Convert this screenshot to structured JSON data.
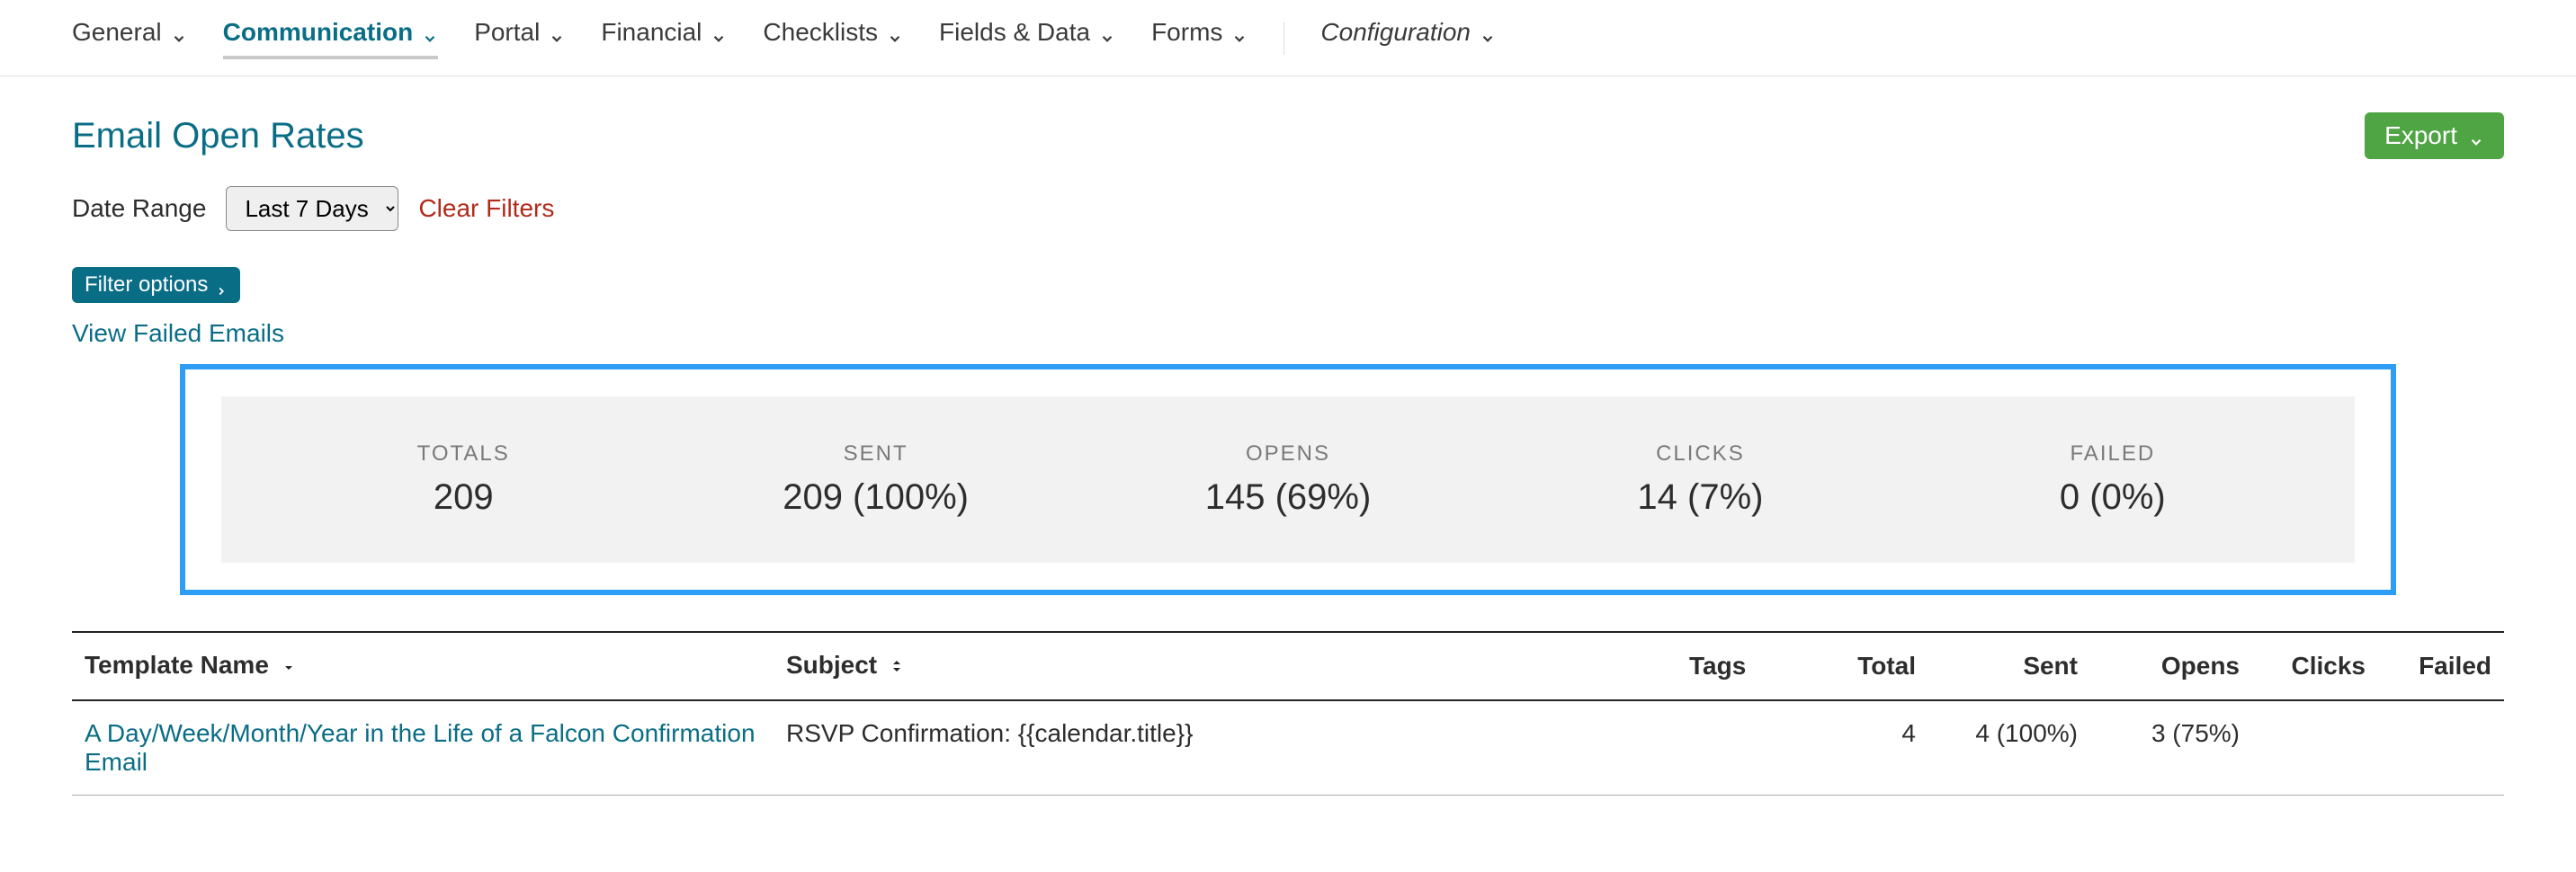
{
  "nav": {
    "items": [
      {
        "label": "General"
      },
      {
        "label": "Communication",
        "active": true
      },
      {
        "label": "Portal"
      },
      {
        "label": "Financial"
      },
      {
        "label": "Checklists"
      },
      {
        "label": "Fields & Data"
      },
      {
        "label": "Forms"
      }
    ],
    "config_label": "Configuration"
  },
  "header": {
    "title": "Email Open Rates",
    "export_label": "Export"
  },
  "filters": {
    "date_range_label": "Date Range",
    "date_range_value": "Last 7 Days",
    "clear_label": "Clear Filters",
    "filter_options_label": "Filter options",
    "view_failed_label": "View Failed Emails"
  },
  "stats": {
    "totals": {
      "label": "TOTALS",
      "value": "209"
    },
    "sent": {
      "label": "SENT",
      "value": "209 (100%)"
    },
    "opens": {
      "label": "OPENS",
      "value": "145 (69%)"
    },
    "clicks": {
      "label": "CLICKS",
      "value": "14 (7%)"
    },
    "failed": {
      "label": "FAILED",
      "value": "0 (0%)"
    }
  },
  "table": {
    "columns": {
      "template": "Template Name",
      "subject": "Subject",
      "tags": "Tags",
      "total": "Total",
      "sent": "Sent",
      "opens": "Opens",
      "clicks": "Clicks",
      "failed": "Failed"
    },
    "rows": [
      {
        "template": "A Day/Week/Month/Year in the Life of a Falcon Confirmation Email",
        "subject": "RSVP Confirmation: {{calendar.title}}",
        "tags": "",
        "total": "4",
        "sent": "4 (100%)",
        "opens": "3 (75%)",
        "clicks": "",
        "failed": ""
      }
    ]
  }
}
